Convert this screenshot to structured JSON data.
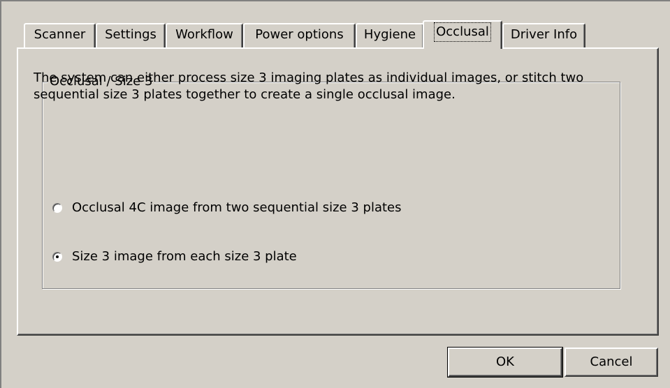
{
  "tabs": [
    {
      "label": "Scanner",
      "active": false
    },
    {
      "label": "Settings",
      "active": false
    },
    {
      "label": "Workflow",
      "active": false
    },
    {
      "label": "Power options",
      "active": false
    },
    {
      "label": "Hygiene",
      "active": false
    },
    {
      "label": "Occlusal",
      "active": true
    },
    {
      "label": "Driver Info",
      "active": false
    }
  ],
  "group": {
    "legend": "Occlusal / Size 3",
    "description": "The system can either process size 3 imaging plates as individual images, or stitch two sequential size 3 plates together to create a single occlusal image.",
    "options": [
      {
        "label": "Occlusal 4C image from two sequential size 3 plates",
        "selected": false
      },
      {
        "label": "Size 3 image from each size 3 plate",
        "selected": true
      }
    ]
  },
  "buttons": {
    "ok": "OK",
    "cancel": "Cancel"
  },
  "colors": {
    "face": "#d4d0c8",
    "highlight": "#ffffff",
    "shadow": "#808080",
    "dark_shadow": "#404040"
  }
}
